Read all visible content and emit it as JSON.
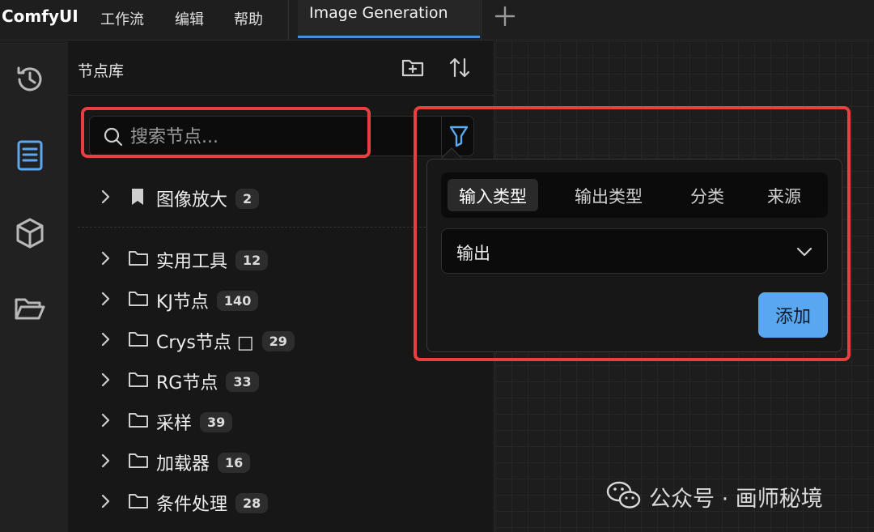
{
  "app": {
    "name": "ComfyUI"
  },
  "menu": [
    {
      "label": "工作流"
    },
    {
      "label": "编辑"
    },
    {
      "label": "帮助"
    }
  ],
  "tabs": [
    {
      "label": "Image Generation",
      "active": true
    }
  ],
  "rail": {
    "items": [
      "history-icon",
      "node-library-icon",
      "model-library-icon",
      "workflows-icon"
    ]
  },
  "panel": {
    "title": "节点库",
    "search_placeholder": "搜索节点...",
    "bookmarks": [
      {
        "label": "图像放大",
        "count": "2"
      }
    ],
    "categories": [
      {
        "label": "实用工具",
        "count": "12"
      },
      {
        "label": "KJ节点",
        "count": "140"
      },
      {
        "label": "Crys节点 □",
        "count": "29"
      },
      {
        "label": "RG节点",
        "count": "33"
      },
      {
        "label": "采样",
        "count": "39"
      },
      {
        "label": "加载器",
        "count": "16"
      },
      {
        "label": "条件处理",
        "count": "28"
      }
    ]
  },
  "filter_popover": {
    "tabs": [
      {
        "label": "输入类型",
        "active": true
      },
      {
        "label": "输出类型",
        "active": false
      },
      {
        "label": "分类",
        "active": false
      },
      {
        "label": "来源",
        "active": false
      }
    ],
    "selected_value": "输出",
    "add_label": "添加"
  },
  "watermark": {
    "text": "公众号 · 画师秘境"
  },
  "colors": {
    "accent": "#58a7f0",
    "tab_underline": "#4a8fd9",
    "highlight": "#e9403f",
    "rail_active": "#5aa8f0"
  }
}
